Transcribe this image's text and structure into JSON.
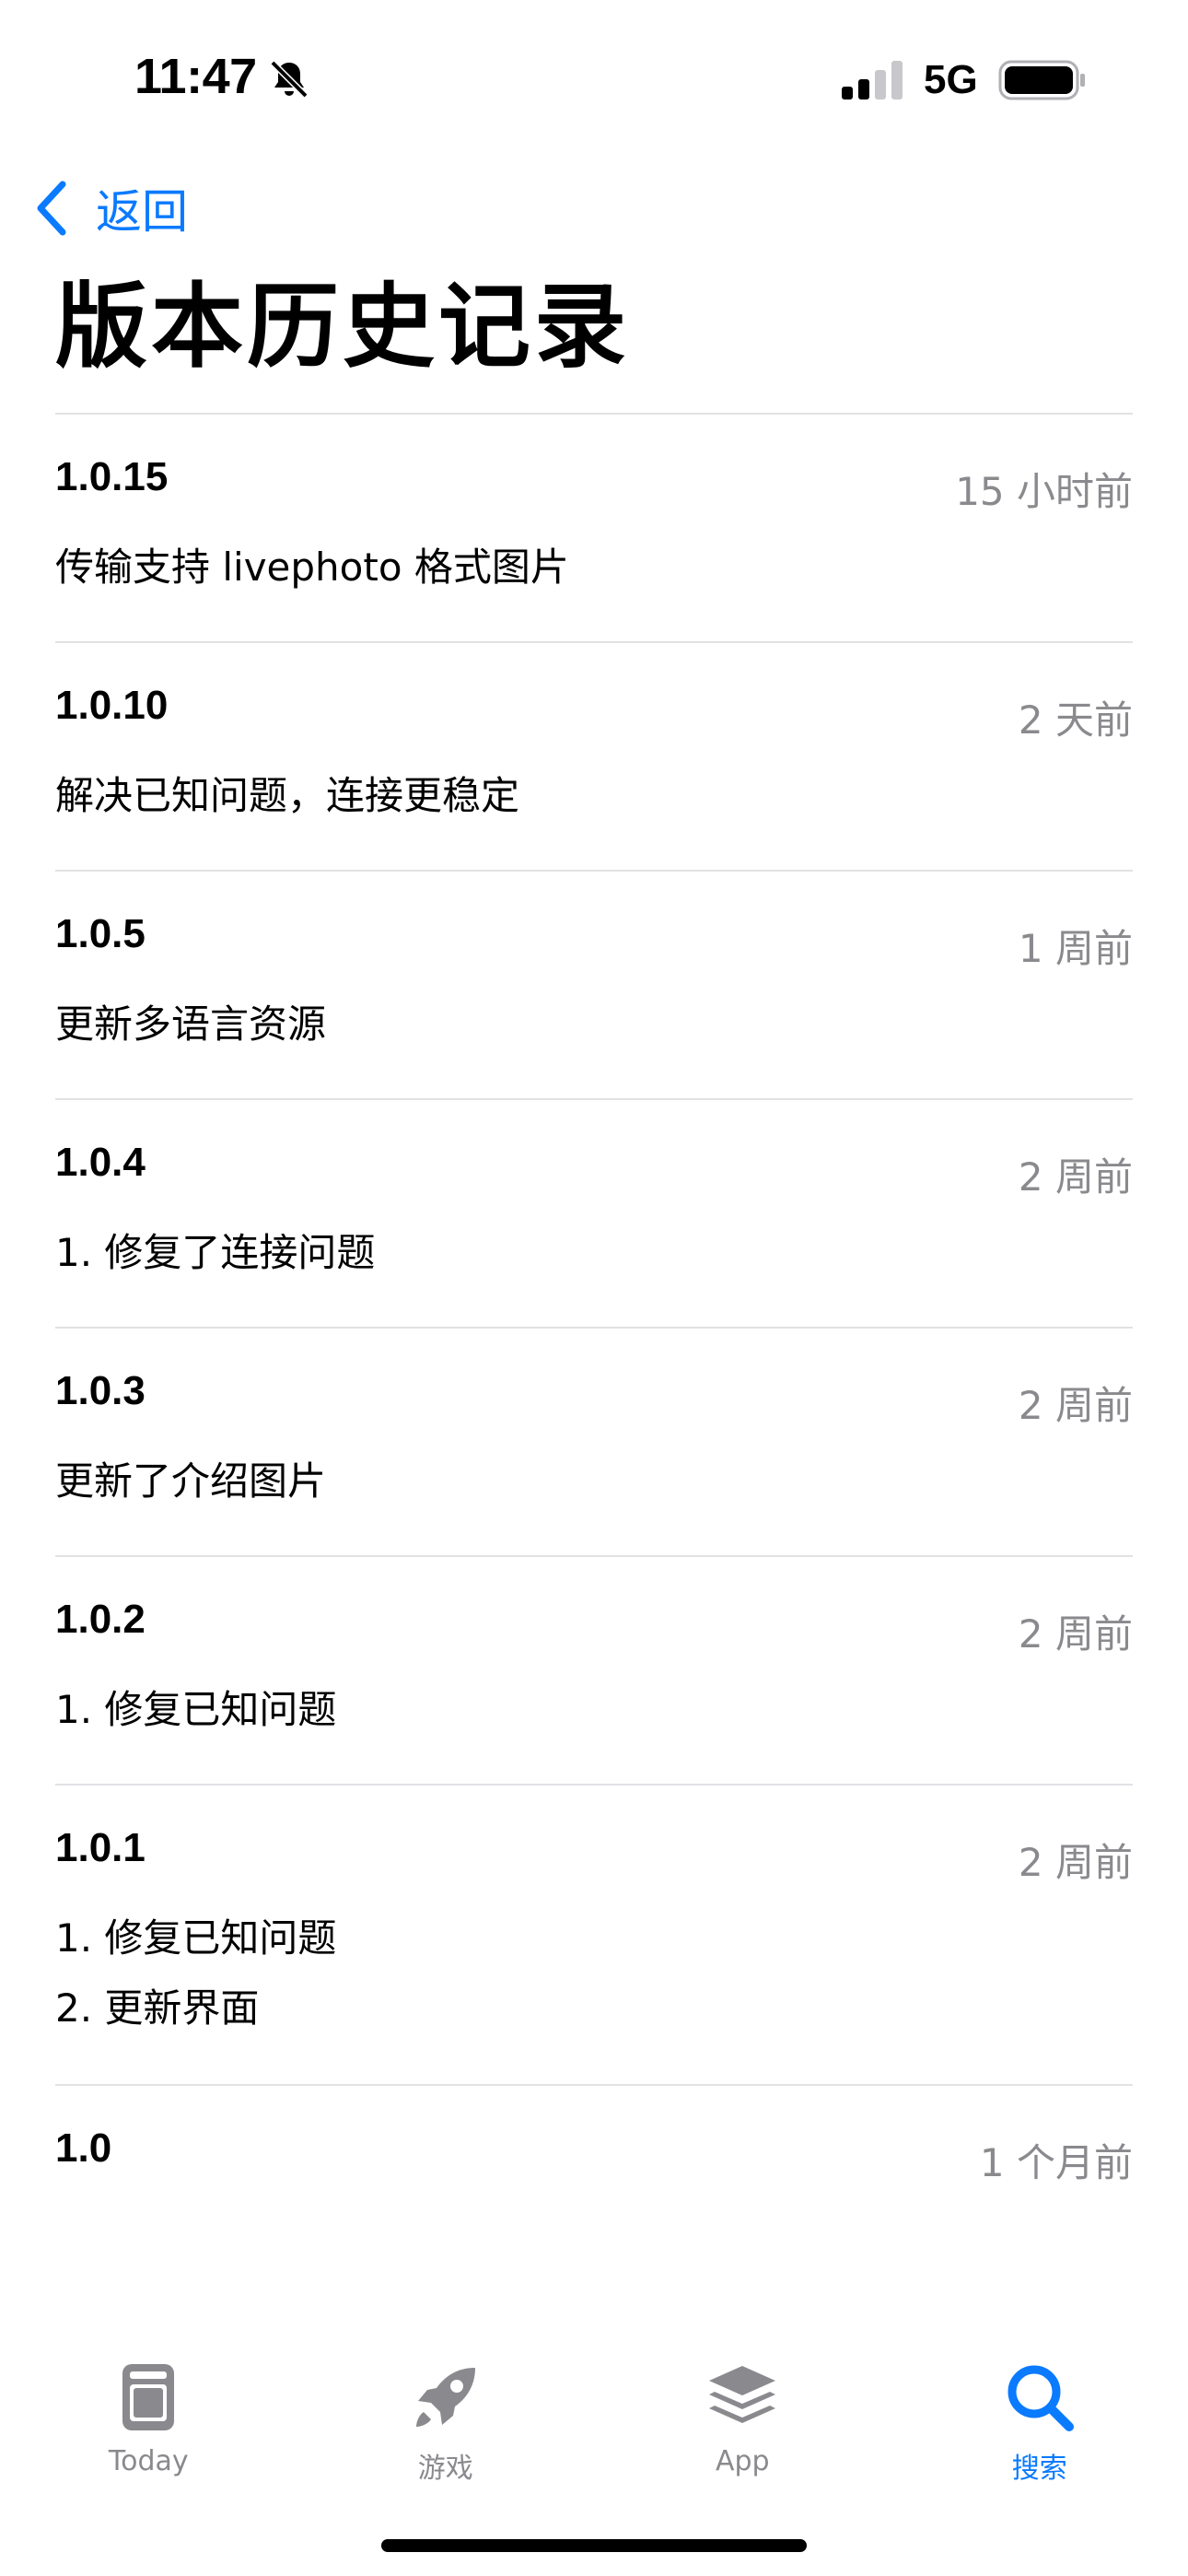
{
  "status_bar": {
    "time": "11:47",
    "network": "5G",
    "icons": [
      "bell-slash-icon",
      "cellular-signal-icon",
      "battery-icon"
    ]
  },
  "nav": {
    "back_label": "返回",
    "title": "版本历史记录"
  },
  "versions": [
    {
      "number": "1.0.15",
      "date": "15 小时前",
      "notes": "传输支持 livephoto 格式图片"
    },
    {
      "number": "1.0.10",
      "date": "2 天前",
      "notes": "解决已知问题，连接更稳定"
    },
    {
      "number": "1.0.5",
      "date": "1 周前",
      "notes": "更新多语言资源"
    },
    {
      "number": "1.0.4",
      "date": "2 周前",
      "notes": "1. 修复了连接问题"
    },
    {
      "number": "1.0.3",
      "date": "2 周前",
      "notes": "更新了介绍图片"
    },
    {
      "number": "1.0.2",
      "date": "2 周前",
      "notes": "1. 修复已知问题"
    },
    {
      "number": "1.0.1",
      "date": "2 周前",
      "notes": "1. 修复已知问题\n2. 更新界面"
    },
    {
      "number": "1.0",
      "date": "1 个月前",
      "notes": ""
    }
  ],
  "tab_bar": {
    "tabs": [
      {
        "label": "Today",
        "icon": "today-icon",
        "active": false
      },
      {
        "label": "游戏",
        "icon": "rocket-icon",
        "active": false
      },
      {
        "label": "App",
        "icon": "app-stack-icon",
        "active": false
      },
      {
        "label": "搜索",
        "icon": "search-icon",
        "active": true
      }
    ]
  },
  "colors": {
    "accent": "#0a7aff",
    "secondary_text": "#8a8a8e",
    "separator": "#e2e2e5",
    "inactive_icon": "#8a8a8e"
  }
}
